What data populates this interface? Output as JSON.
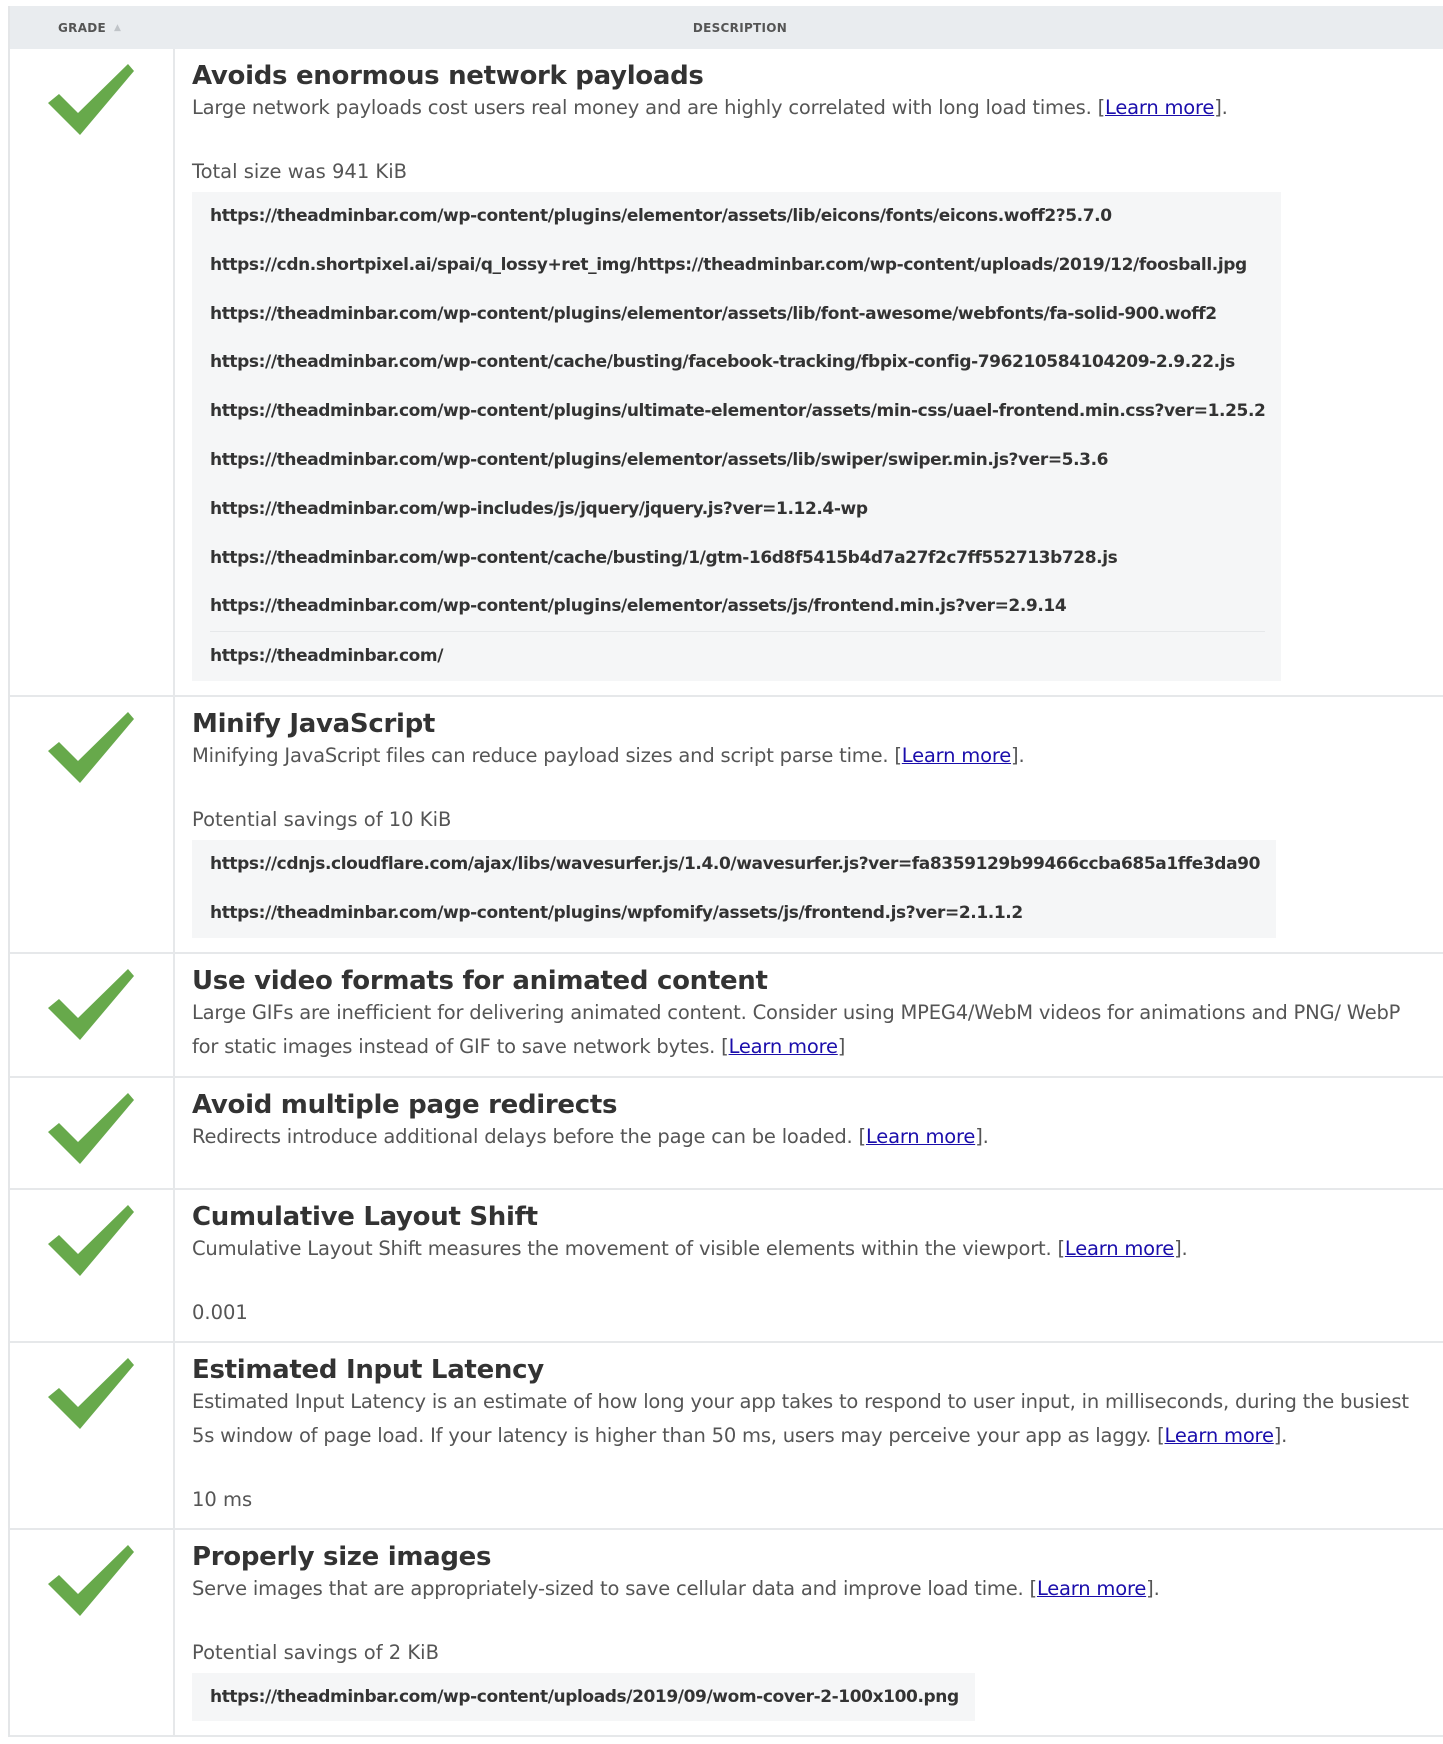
{
  "header": {
    "grade": "GRADE",
    "description": "DESCRIPTION"
  },
  "icons": {
    "grade": "checkmark-icon",
    "sort": "sort-up-icon"
  },
  "colors": {
    "check": "#67a94b",
    "link": "#1a0dab",
    "header_bg": "#e9ecef",
    "url_bg": "#f5f6f7"
  },
  "rows": [
    {
      "title": "Avoids enormous network payloads",
      "description": "Large network payloads cost users real money and are highly correlated with long load times.",
      "link_text": "Learn more",
      "suffix": ".",
      "metric": "Total size was 941 KiB",
      "urls": [
        "https://theadminbar.com/wp-content/plugins/elementor/assets/lib/eicons/fonts/eicons.woff2?5.7.0",
        "https://cdn.shortpixel.ai/spai/q_lossy+ret_img/https://theadminbar.com/wp-content/uploads/2019/12/foosball.jpg",
        "https://theadminbar.com/wp-content/plugins/elementor/assets/lib/font-awesome/webfonts/fa-solid-900.woff2",
        "https://theadminbar.com/wp-content/cache/busting/facebook-tracking/fbpix-config-796210584104209-2.9.22.js",
        "https://theadminbar.com/wp-content/plugins/ultimate-elementor/assets/min-css/uael-frontend.min.css?ver=1.25.2",
        "https://theadminbar.com/wp-content/plugins/elementor/assets/lib/swiper/swiper.min.js?ver=5.3.6",
        "https://theadminbar.com/wp-includes/js/jquery/jquery.js?ver=1.12.4-wp",
        "https://theadminbar.com/wp-content/cache/busting/1/gtm-16d8f5415b4d7a27f2c7ff552713b728.js",
        "https://theadminbar.com/wp-content/plugins/elementor/assets/js/frontend.min.js?ver=2.9.14",
        "https://theadminbar.com/"
      ]
    },
    {
      "title": "Minify JavaScript",
      "description": "Minifying JavaScript files can reduce payload sizes and script parse time.",
      "link_text": "Learn more",
      "suffix": ".",
      "metric": "Potential savings of 10 KiB",
      "urls": [
        "https://cdnjs.cloudflare.com/ajax/libs/wavesurfer.js/1.4.0/wavesurfer.js?ver=fa8359129b99466ccba685a1ffe3da90",
        "https://theadminbar.com/wp-content/plugins/wpfomify/assets/js/frontend.js?ver=2.1.1.2"
      ]
    },
    {
      "title": "Use video formats for animated content",
      "description": "Large GIFs are inefficient for delivering animated content. Consider using MPEG4/WebM videos for animations and PNG/ WebP for static images instead of GIF to save network bytes.",
      "link_text": "Learn more",
      "suffix": "",
      "metric": "",
      "urls": []
    },
    {
      "title": "Avoid multiple page redirects",
      "description": "Redirects introduce additional delays before the page can be loaded.",
      "link_text": "Learn more",
      "suffix": ".",
      "metric": "",
      "urls": []
    },
    {
      "title": "Cumulative Layout Shift",
      "description": "Cumulative Layout Shift measures the movement of visible elements within the viewport.",
      "link_text": "Learn more",
      "suffix": ".",
      "metric": "0.001",
      "urls": []
    },
    {
      "title": "Estimated Input Latency",
      "description": "Estimated Input Latency is an estimate of how long your app takes to respond to user input, in milliseconds, during the busiest 5s window of page load. If your latency is higher than 50 ms, users may perceive your app as laggy.",
      "link_text": "Learn more",
      "suffix": ".",
      "metric": "10 ms",
      "urls": []
    },
    {
      "title": "Properly size images",
      "description": "Serve images that are appropriately-sized to save cellular data and improve load time.",
      "link_text": "Learn more",
      "suffix": ".",
      "metric": "Potential savings of 2 KiB",
      "urls": [
        "https://theadminbar.com/wp-content/uploads/2019/09/wom-cover-2-100x100.png"
      ]
    }
  ]
}
